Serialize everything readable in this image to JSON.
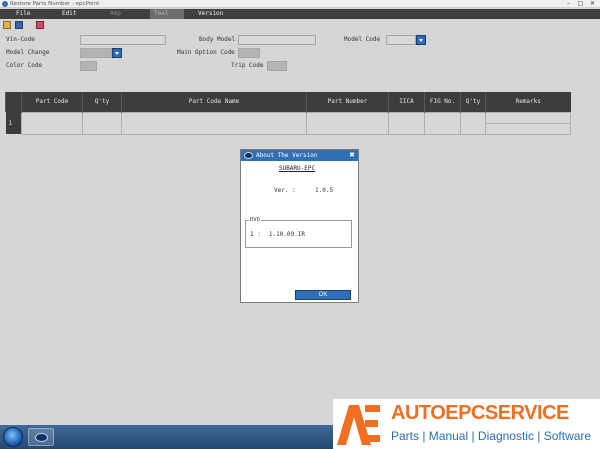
{
  "window": {
    "title": "Restore Parts Number - epcPoint"
  },
  "menu": [
    {
      "label": "File",
      "state": "normal"
    },
    {
      "label": "Edit",
      "state": "normal"
    },
    {
      "label": "Amp",
      "state": "dim"
    },
    {
      "label": "Tool",
      "state": "active"
    },
    {
      "label": "Version",
      "state": "normal"
    }
  ],
  "toolbar": {
    "icons": [
      "open-folder-icon",
      "save-icon",
      "print-icon"
    ]
  },
  "form": {
    "vin_code": {
      "label": "Vin-Code",
      "value": ""
    },
    "body_model": {
      "label": "Body Model",
      "value": ""
    },
    "model_code": {
      "label": "Model Code",
      "value": ""
    },
    "model_change": {
      "label": "Model Change",
      "value": ""
    },
    "main_option_code": {
      "label": "Main Option Code",
      "value": ""
    },
    "color_code": {
      "label": "Color Code",
      "value": ""
    },
    "trip_code": {
      "label": "Trip Code",
      "value": ""
    }
  },
  "table": {
    "columns": [
      "",
      "Part Code",
      "Q'ty",
      "Part Code Name",
      "Part Number",
      "IICA",
      "FIG No.",
      "Q'ty",
      "Remarks"
    ],
    "rows": [
      {
        "num": "1",
        "cells": [
          "",
          "",
          "",
          "",
          "",
          "",
          "",
          ""
        ]
      }
    ]
  },
  "dialog": {
    "title": "About The Version",
    "brand": "SUBARU-EPC",
    "version_label": "Ver. :",
    "version_value": "1.0.5",
    "dvd_legend": "DVD",
    "dvd_row_index": "1 :",
    "dvd_row_value": "1.10.09.IR",
    "ok_label": "OK"
  },
  "watermark": {
    "brand": "AUTOEPCSERVICE",
    "tagline": "Parts | Manual | Diagnostic | Software",
    "colors": {
      "orange": "#f26f21",
      "blue": "#2a6fb5"
    }
  },
  "colors": {
    "menubar": "#404040",
    "accent_blue": "#2f6fb5",
    "header": "#3c3c3c",
    "background": "#d6d6d6"
  }
}
